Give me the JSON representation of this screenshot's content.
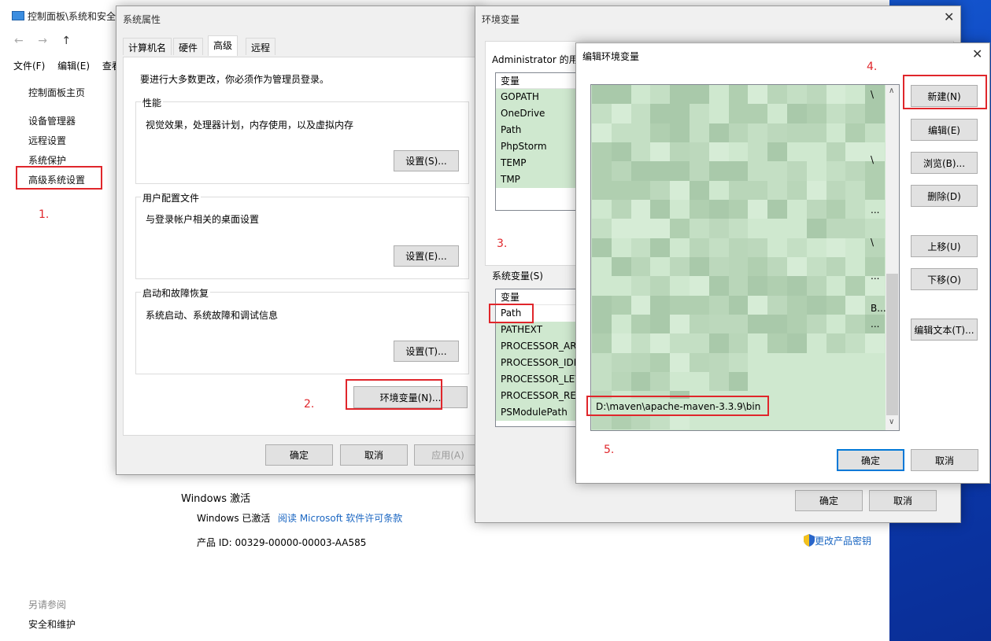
{
  "control_panel": {
    "title": "控制面板\\系统和安全",
    "nav": [
      "←",
      "→",
      "↑"
    ],
    "menu": [
      "文件(F)",
      "编辑(E)",
      "查看"
    ],
    "sidebar_home": "控制面板主页",
    "sidebar_links": [
      "设备管理器",
      "远程设置",
      "系统保护",
      "高级系统设置"
    ],
    "see_also_title": "另请参阅",
    "see_also_link": "安全和维护",
    "activation_title": "Windows 激活",
    "activation_status": "Windows 已激活",
    "activation_link": "阅读 Microsoft 软件许可条款",
    "product_id": "产品 ID: 00329-00000-00003-AA585",
    "change_key": "更改产品密钥"
  },
  "sys_props": {
    "title": "系统属性",
    "tabs": [
      "计算机名",
      "硬件",
      "高级",
      "远程"
    ],
    "admin_note": "要进行大多数更改，你必须作为管理员登录。",
    "perf_label": "性能",
    "perf_desc": "视觉效果，处理器计划，内存使用，以及虚拟内存",
    "perf_btn": "设置(S)...",
    "profile_label": "用户配置文件",
    "profile_desc": "与登录帐户相关的桌面设置",
    "profile_btn": "设置(E)...",
    "startup_label": "启动和故障恢复",
    "startup_desc": "系统启动、系统故障和调试信息",
    "startup_btn": "设置(T)...",
    "env_btn": "环境变量(N)...",
    "ok": "确定",
    "cancel": "取消",
    "apply": "应用(A)"
  },
  "env_vars": {
    "title": "环境变量",
    "user_label": "Administrator 的用户变量(U)",
    "col_var": "变量",
    "user_rows": [
      "GOPATH",
      "OneDrive",
      "Path",
      "PhpStorm",
      "TEMP",
      "TMP"
    ],
    "sys_label": "系统变量(S)",
    "sys_rows": [
      "Path",
      "PATHEXT",
      "PROCESSOR_ARCHITECTURE",
      "PROCESSOR_IDENTIFIER",
      "PROCESSOR_LEVEL",
      "PROCESSOR_REVISION",
      "PSModulePath"
    ],
    "ok": "确定",
    "cancel": "取消"
  },
  "edit_env": {
    "title": "编辑环境变量",
    "right_snippets": [
      "\\",
      "\\",
      "...",
      "\\",
      "...",
      "B...",
      "..."
    ],
    "new_entry": "D:\\maven\\apache-maven-3.3.9\\bin",
    "btn_new": "新建(N)",
    "btn_edit": "编辑(E)",
    "btn_browse": "浏览(B)...",
    "btn_delete": "删除(D)",
    "btn_up": "上移(U)",
    "btn_down": "下移(O)",
    "btn_edit_text": "编辑文本(T)...",
    "ok": "确定",
    "cancel": "取消"
  },
  "annotations": [
    "1.",
    "2.",
    "3.",
    "4.",
    "5."
  ],
  "colors": {
    "highlight_green": "#cfe8cf",
    "annotation_red": "#e0262b",
    "link_blue": "#1a66c2",
    "accent_blue": "#0078d7"
  }
}
